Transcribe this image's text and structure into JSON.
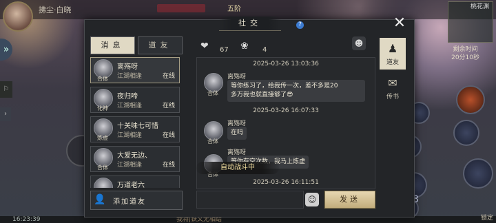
{
  "background": {
    "top_name": "拂尘·白晓",
    "top_level": "五阶",
    "right_panel_title": "桃花渊",
    "right_time_label": "剩余时间",
    "right_time_value": "20分10秒",
    "bottom_time": "16:23:39",
    "bottom_center_text": "我特|铁又无相结",
    "bottom_right_label": "锁定",
    "skill_number": "3"
  },
  "panel": {
    "title": "社交",
    "close_symbol": "✕"
  },
  "tabs": [
    {
      "label": "消息",
      "active": true
    },
    {
      "label": "道友",
      "active": false
    }
  ],
  "friends": [
    {
      "name": "离殇呀",
      "realm": "合体",
      "group": "江湖相逢",
      "status": "在线",
      "selected": true
    },
    {
      "name": "夜归啼",
      "realm": "化神",
      "group": "江湖相逢",
      "status": "在线",
      "selected": false
    },
    {
      "name": "十关味七可惜",
      "realm": "炼虚",
      "group": "江湖相逢",
      "status": "在线",
      "selected": false
    },
    {
      "name": "大爱无边、",
      "realm": "合体",
      "group": "江湖相逢",
      "status": "在线",
      "selected": false
    },
    {
      "name": "万道老六",
      "realm": "",
      "group": "",
      "status": "",
      "selected": false
    }
  ],
  "add_friend": {
    "label": "添加道友"
  },
  "stats": {
    "hearts": "67",
    "flowers": "4"
  },
  "chat": {
    "messages": [
      {
        "timestamp": "2025-03-26 13:03:36",
        "sender": "离殇呀",
        "realm": "合体",
        "text_line1": "等你练习了，给我传一次，差不多是20",
        "text_line2": "多万我也就直接够了😎"
      },
      {
        "timestamp": "2025-03-26 16:07:33",
        "sender": "离殇呀",
        "realm": "合体",
        "text_line1": "在吗",
        "text_line2": ""
      },
      {
        "timestamp": "",
        "sender": "离殇呀",
        "realm": "合体",
        "text_line1": "等你有空次数，我马上炼虚",
        "text_line2": ""
      }
    ],
    "last_timestamp": "2025-03-26 16:11:51",
    "autobattle": "自动战斗中"
  },
  "send": {
    "label": "发送"
  },
  "side_tabs": [
    {
      "label": "道友",
      "icon": "person-icon",
      "active": true
    },
    {
      "label": "传书",
      "icon": "message-icon",
      "active": false
    }
  ]
}
